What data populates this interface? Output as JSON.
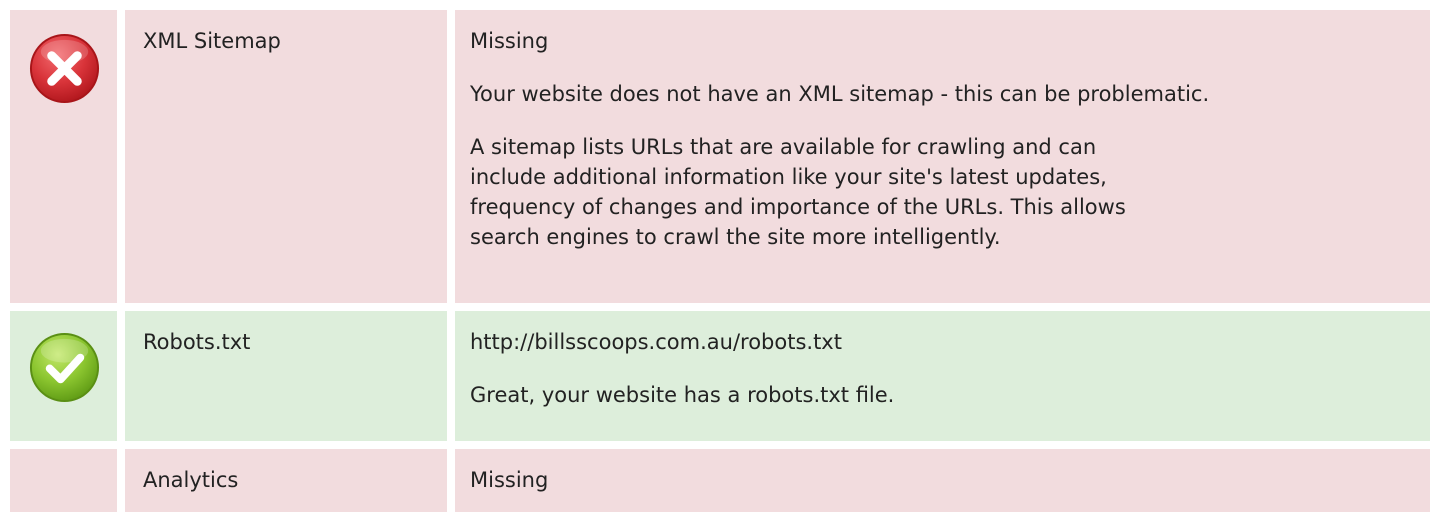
{
  "rows": [
    {
      "name": "XML Sitemap",
      "status": "error",
      "icon": "error-x-icon",
      "value": "Missing",
      "message": "Your website does not have an XML sitemap - this can be problematic.",
      "description": "A sitemap lists URLs that are available for crawling and can include additional information like your site's latest updates, frequency of changes and importance of the URLs. This allows search engines to crawl the site more intelligently."
    },
    {
      "name": "Robots.txt",
      "status": "success",
      "icon": "success-check-icon",
      "value": "http://billsscoops.com.au/robots.txt",
      "message": "Great, your website has a robots.txt file."
    },
    {
      "name": "Analytics",
      "status": "error",
      "value": "Missing"
    }
  ],
  "colors": {
    "error_row": "#f2dcde",
    "success_row": "#ddeedb",
    "error_icon": "#d9343a",
    "success_icon": "#7fbf22"
  }
}
